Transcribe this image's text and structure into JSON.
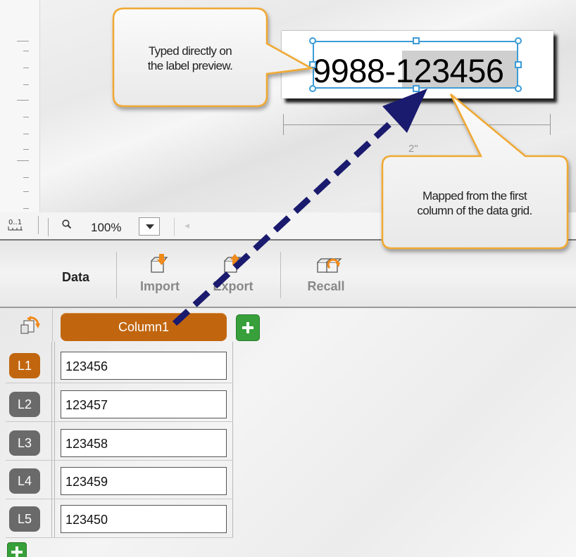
{
  "label_preview": {
    "text": "9988-123456",
    "dimension_label": "2\""
  },
  "status_bar": {
    "zoom_value": "100%",
    "ruler_icon_text": "0..1"
  },
  "toolbar": {
    "group_title": "Data",
    "import_label": "Import",
    "export_label": "Export",
    "recall_label": "Recall"
  },
  "grid": {
    "column_header": "Column1",
    "rows": [
      {
        "label": "L1",
        "value": "123456"
      },
      {
        "label": "L2",
        "value": "123457"
      },
      {
        "label": "L3",
        "value": "123458"
      },
      {
        "label": "L4",
        "value": "123459"
      },
      {
        "label": "L5",
        "value": "123450"
      }
    ]
  },
  "callouts": {
    "top_left": {
      "line1": "Typed directly on",
      "line2": "the label preview."
    },
    "right": {
      "line1": "Mapped from the first",
      "line2": "column of the data grid."
    }
  },
  "colors": {
    "accent_orange": "#c1660f",
    "selection_blue": "#3c9bd6",
    "add_green": "#37a03a",
    "arrow_navy": "#1a1a6e",
    "callout_border": "#f0a830"
  }
}
